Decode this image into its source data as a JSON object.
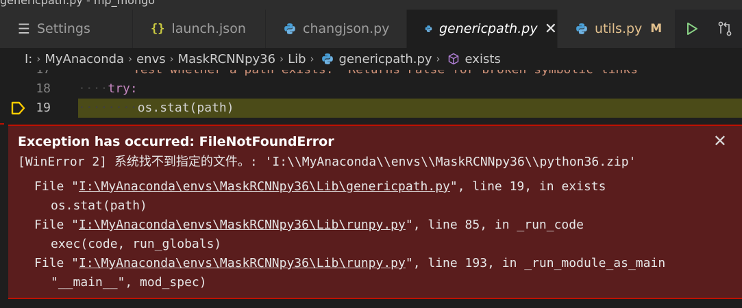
{
  "window": {
    "title_partial": "genericpath.py - mp_mongo"
  },
  "tabs": [
    {
      "label": "Settings",
      "icon": "settings-icon",
      "active": false
    },
    {
      "label": "launch.json",
      "icon": "json-braces-icon",
      "active": false
    },
    {
      "label": "changjson.py",
      "icon": "python-icon",
      "active": false
    },
    {
      "label": "genericpath.py",
      "icon": "python-icon",
      "active": true,
      "close": "✕"
    },
    {
      "label": "utils.py",
      "icon": "python-icon",
      "active": false,
      "modified_badge": "M"
    }
  ],
  "breadcrumb": {
    "items": [
      "I:",
      "MyAnaconda",
      "envs",
      "MaskRCNNpy36",
      "Lib",
      "genericpath.py",
      "exists"
    ],
    "separator": "›"
  },
  "editor": {
    "lines": [
      {
        "num": "17",
        "text": "Test whether a path exists.  Returns False for broken symbolic links"
      },
      {
        "num": "18",
        "keyword": "try",
        "text": ":"
      },
      {
        "num": "19",
        "text": "os.stat(path)"
      }
    ]
  },
  "exception": {
    "title": "Exception has occurred: FileNotFoundError",
    "message": "[WinError 2] 系统找不到指定的文件。: 'I:\\\\MyAnaconda\\\\envs\\\\MaskRCNNpy36\\\\python36.zip'",
    "close": "✕",
    "frames": [
      {
        "prefix": "File \"",
        "path": "I:\\MyAnaconda\\envs\\MaskRCNNpy36\\Lib\\genericpath.py",
        "suffix": "\", line 19, in exists",
        "code": "os.stat(path)"
      },
      {
        "prefix": "File \"",
        "path": "I:\\MyAnaconda\\envs\\MaskRCNNpy36\\Lib\\runpy.py",
        "suffix": "\", line 85, in _run_code",
        "code": "exec(code, run_globals)"
      },
      {
        "prefix": "File \"",
        "path": "I:\\MyAnaconda\\envs\\MaskRCNNpy36\\Lib\\runpy.py",
        "suffix": "\", line 193, in _run_module_as_main",
        "code": "\"__main__\", mod_spec)"
      }
    ]
  },
  "colors": {
    "exception_bg": "#5a1d1d",
    "exception_border": "#be1100",
    "current_line": "#4b4b18",
    "run_green": "#89d185"
  }
}
